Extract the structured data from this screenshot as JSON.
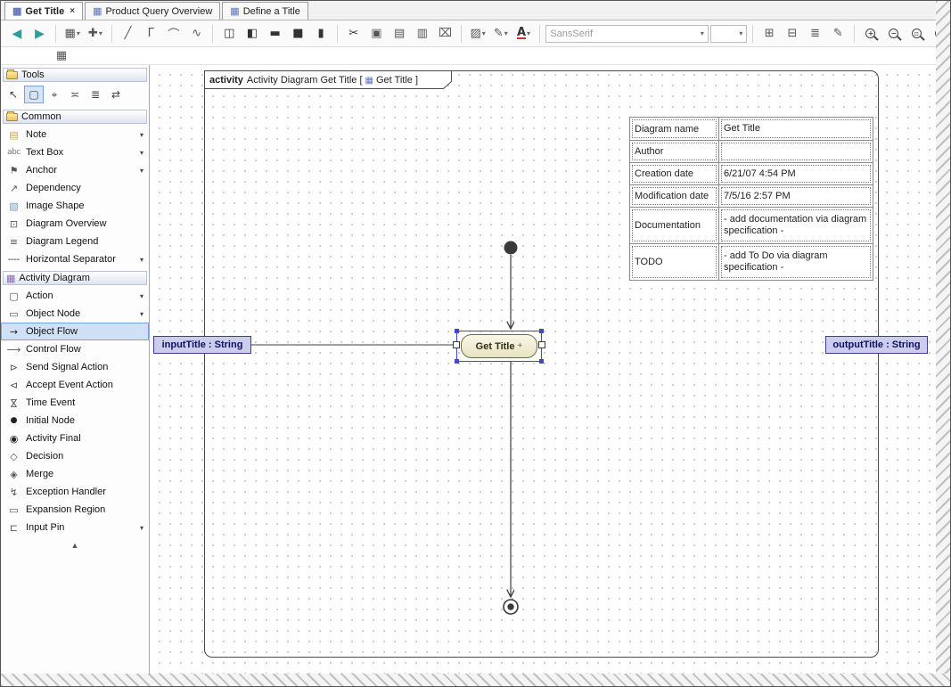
{
  "ui": {
    "caret": "▾",
    "close": "×",
    "scroll_up": "▲",
    "tab_icon": "▦"
  },
  "tabs": [
    {
      "label": "Get Title"
    },
    {
      "label": "Product Query Overview"
    },
    {
      "label": "Define a Title"
    }
  ],
  "toolbar": {
    "icons": {
      "nav_back": "◀",
      "nav_forward": "▶",
      "layout_tree": "▦",
      "add_related": "✚",
      "line_diagonal": "╱",
      "line_rectilinear": "Γ",
      "line_curved": "⌒",
      "line_spline": "∿",
      "insert_left": "◫",
      "insert_right": "◧",
      "bar_wide": "▬",
      "bar_square": "■",
      "bar_tall": "▮",
      "cut": "✂",
      "copy": "▣",
      "paste": "▤",
      "paste_special": "▥",
      "delete": "⌧",
      "fill_color": "▨",
      "pen_color": "✎",
      "font_color": "A",
      "group": "⊞",
      "ungroup": "⊟",
      "order": "≣",
      "edit": "✎"
    },
    "font_family": {
      "value": "SansSerif"
    },
    "font_size": {
      "value": ""
    },
    "zoom": {
      "in": "+",
      "out": "−",
      "fit": "▫",
      "one": "1"
    },
    "secondary_icon": "▦"
  },
  "sidebar": {
    "tools": {
      "header": "Tools",
      "buttons": [
        {
          "glyph": "↖"
        },
        {
          "glyph": "▢"
        },
        {
          "glyph": "⌖"
        },
        {
          "glyph": "≍"
        },
        {
          "glyph": "≣"
        },
        {
          "glyph": "⇄"
        }
      ]
    },
    "common": {
      "header": "Common",
      "items": [
        {
          "label": "Note",
          "icon": "▤"
        },
        {
          "label": "Text Box",
          "icon": "abc"
        },
        {
          "label": "Anchor",
          "icon": "⚑"
        },
        {
          "label": "Dependency",
          "icon": "↗"
        },
        {
          "label": "Image Shape",
          "icon": "▧"
        },
        {
          "label": "Diagram Overview",
          "icon": "⊡"
        },
        {
          "label": "Diagram Legend",
          "icon": "≡"
        },
        {
          "label": "Horizontal Separator",
          "icon": "╌╌"
        }
      ]
    },
    "activity": {
      "header": "Activity Diagram",
      "header_icon": "▦",
      "items": [
        {
          "label": "Action",
          "icon": "▢"
        },
        {
          "label": "Object Node",
          "icon": "▭"
        },
        {
          "label": "Object Flow",
          "icon": "→"
        },
        {
          "label": "Control Flow",
          "icon": "⟶"
        },
        {
          "label": "Send Signal Action",
          "icon": "⊳"
        },
        {
          "label": "Accept Event Action",
          "icon": "⊲"
        },
        {
          "label": "Time Event",
          "icon": "⋈"
        },
        {
          "label": "Initial Node",
          "icon": "●"
        },
        {
          "label": "Activity Final",
          "icon": "◉"
        },
        {
          "label": "Decision",
          "icon": "◇"
        },
        {
          "label": "Merge",
          "icon": "◈"
        },
        {
          "label": "Exception Handler",
          "icon": "↯"
        },
        {
          "label": "Expansion Region",
          "icon": "▭"
        },
        {
          "label": "Input Pin",
          "icon": "⊏"
        }
      ]
    }
  },
  "canvas": {
    "frame": {
      "keyword": "activity",
      "title": "Activity Diagram Get Title [",
      "icon": "▦",
      "bracket_name": "Get Title ]"
    },
    "action": {
      "label": "Get Title",
      "pin_plus": "+"
    },
    "input_object": {
      "label": "inputTitle : String"
    },
    "output_object": {
      "label": "outputTitle : String"
    },
    "info_table": {
      "rows": [
        {
          "key": "Diagram name",
          "value": "Get Title"
        },
        {
          "key": "Author",
          "value": ""
        },
        {
          "key": "Creation date",
          "value": "6/21/07 4:54 PM"
        },
        {
          "key": "Modification date",
          "value": "7/5/16 2:57 PM"
        },
        {
          "key": "Documentation",
          "value": "- add documentation via diagram specification -"
        },
        {
          "key": "TODO",
          "value": "- add To Do via diagram specification -"
        }
      ]
    }
  },
  "colors": {
    "selection": "#4049c8",
    "action_fill": "#f2eed6",
    "object_fill": "#ccccee",
    "accent_teal": "#2a9d9d"
  }
}
